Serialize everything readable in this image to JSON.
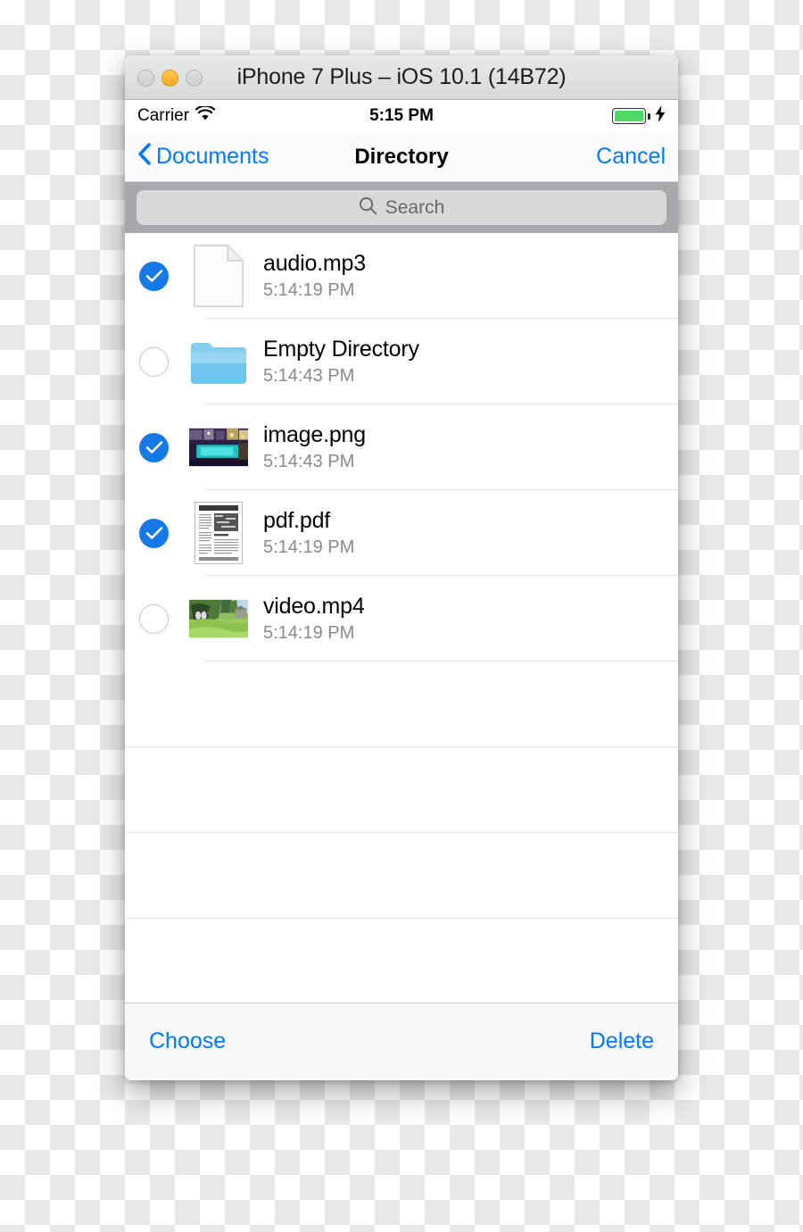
{
  "window": {
    "title": "iPhone 7 Plus – iOS 10.1 (14B72)",
    "traffic_lights": [
      {
        "name": "close-button",
        "state": "disabled",
        "color": "#d6d6d6"
      },
      {
        "name": "minimize-button",
        "state": "enabled",
        "color": "#f5a623"
      },
      {
        "name": "maximize-button",
        "state": "disabled",
        "color": "#d6d6d6"
      }
    ]
  },
  "status_bar": {
    "carrier": "Carrier",
    "wifi_icon": "wifi-icon",
    "time": "5:15 PM",
    "battery_icon": "battery-full-icon",
    "battery_level": 100,
    "battery_color": "#4cd964",
    "charging_icon": "lightning-bolt-icon"
  },
  "nav_bar": {
    "back_icon": "chevron-left-icon",
    "back_label": "Documents",
    "title": "Directory",
    "cancel_label": "Cancel",
    "tint_color": "#007aff"
  },
  "search": {
    "icon": "search-icon",
    "placeholder": "Search",
    "value": ""
  },
  "file_list": {
    "rows": [
      {
        "name": "audio.mp3",
        "timestamp": "5:14:19 PM",
        "selected": true,
        "icon": "generic-document-icon",
        "kind": "file"
      },
      {
        "name": "Empty Directory",
        "timestamp": "5:14:43 PM",
        "selected": false,
        "icon": "folder-icon",
        "kind": "folder"
      },
      {
        "name": "image.png",
        "timestamp": "5:14:43 PM",
        "selected": true,
        "icon": "image-thumbnail",
        "kind": "image"
      },
      {
        "name": "pdf.pdf",
        "timestamp": "5:14:19 PM",
        "selected": true,
        "icon": "pdf-page-thumbnail",
        "kind": "pdf"
      },
      {
        "name": "video.mp4",
        "timestamp": "5:14:19 PM",
        "selected": false,
        "icon": "video-thumbnail",
        "kind": "video"
      }
    ],
    "empty_row_count": 4,
    "selected_count": 3
  },
  "toolbar": {
    "choose_label": "Choose",
    "delete_label": "Delete",
    "tint_color": "#007aff"
  },
  "colors": {
    "ios_blue": "#007aff",
    "checkbox_blue": "#1579e8",
    "battery_green": "#4cd964",
    "folder_blue": "#74c8f0",
    "search_band": "#a7a7ac"
  }
}
